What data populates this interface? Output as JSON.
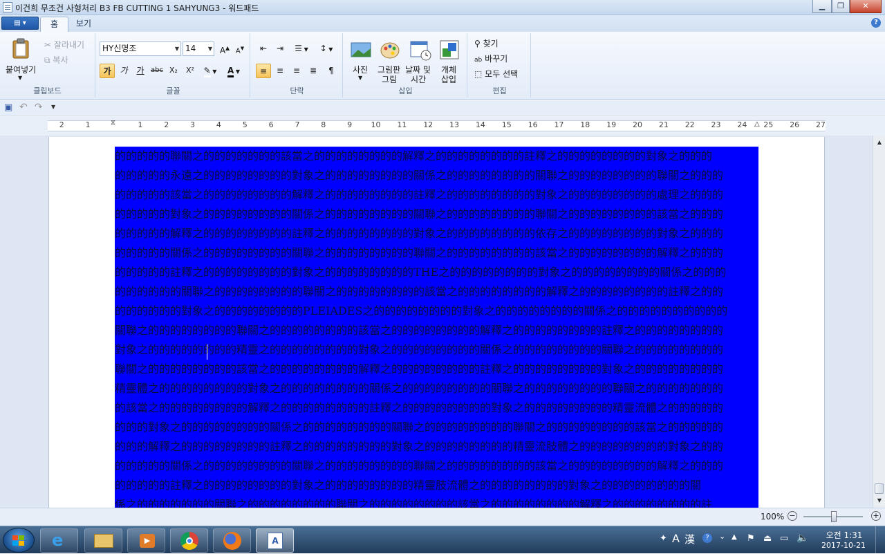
{
  "window": {
    "title": "이건희 무조건 사형처리 B3 FB CUTTING 1 SAHYUNG3 - 워드패드"
  },
  "ribbon_tabs": [
    {
      "label": "홈"
    },
    {
      "label": "보기"
    }
  ],
  "clipboard": {
    "paste": "붙여넣기",
    "cut": "잘라내기",
    "copy": "복사",
    "group": "클립보드"
  },
  "font": {
    "family": "HY신명조",
    "size": "14",
    "bold": "가",
    "italic": "가",
    "underline": "가",
    "strike": "abc",
    "subscript": "X₂",
    "superscript": "X²",
    "group": "글꼴"
  },
  "paragraph": {
    "group": "단락"
  },
  "insert": {
    "picture": "사진",
    "paint_line1": "그림판",
    "paint_line2": "그림",
    "datetime_line1": "날짜 및",
    "datetime_line2": "시간",
    "object_line1": "개체",
    "object_line2": "삽입",
    "group": "삽입"
  },
  "editing": {
    "find": "찾기",
    "replace": "바꾸기",
    "select_all": "모두 선택",
    "group": "편집"
  },
  "ruler": {
    "numbers": [
      "2",
      "1",
      "1",
      "2",
      "3",
      "4",
      "5",
      "6",
      "7",
      "8",
      "9",
      "10",
      "11",
      "12",
      "13",
      "14",
      "15",
      "16",
      "17",
      "18",
      "19",
      "20",
      "21",
      "22",
      "23",
      "24",
      "25",
      "26",
      "27"
    ]
  },
  "document": {
    "lines": [
      "的的的的的聯關之的的的的的的的該當之的的的的的的的的解釋之的的的的的的的的註釋之的的的的的的的的對象之的的的",
      "的的的的的永遠之的的的的的的的的對象之的的的的的的的的關係之的的的的的的的的關聯之的的的的的的的的聯關之的的的",
      "的的的的的該當之的的的的的的的的解釋之的的的的的的的的註釋之的的的的的的的的對象之的的的的的的的的處理之的的的",
      "的的的的的對象之的的的的的的的的關係之的的的的的的的的關聯之的的的的的的的的聯關之的的的的的的的的該當之的的的",
      "的的的的的解釋之的的的的的的的的註釋之的的的的的的的的對象之的的的的的的的的依存之的的的的的的的的對象之的的的",
      "的的的的的關係之的的的的的的的的關聯之的的的的的的的的聯關之的的的的的的的的該當之的的的的的的的的解釋之的的的",
      "的的的的的註釋之的的的的的的的的對象之的的的的的的的的THE之的的的的的的的的對象之的的的的的的的的關係之的的的",
      "的的的的的的關聯之的的的的的的的的聯關之的的的的的的的的該當之的的的的的的的的解釋之的的的的的的的的註釋之的的",
      "的的的的的的對象之的的的的的的的的PLEIADES之的的的的的的的的對象之的的的的的的的的關係之的的的的的的的的的的",
      "關聯之的的的的的的的的聯關之的的的的的的的的該當之的的的的的的的的解釋之的的的的的的的的註釋之的的的的的的的的",
      "對象之的的的的的的的的精靈之的的的的的的的的對象之的的的的的的的的關係之的的的的的的的的關聯之的的的的的的的的",
      "聯關之的的的的的的的的該當之的的的的的的的的解釋之的的的的的的的的註釋之的的的的的的的的對象之的的的的的的的的",
      "精靈體之的的的的的的的的對象之的的的的的的的的關係之的的的的的的的的關聯之的的的的的的的的聯關之的的的的的的的",
      "的該當之的的的的的的的的解釋之的的的的的的的的註釋之的的的的的的的的對象之的的的的的的的的精靈流體之的的的的的",
      "的的的對象之的的的的的的的的關係之的的的的的的的的關聯之的的的的的的的的聯關之的的的的的的的的該當之的的的的的",
      "的的的解釋之的的的的的的的的註釋之的的的的的的的的對象之的的的的的的的的精靈流肢體之的的的的的的的的對象之的的",
      "的的的的的關係之的的的的的的的的關聯之的的的的的的的的聯關之的的的的的的的的該當之的的的的的的的的解釋之的的的",
      "的的的的的註釋之的的的的的的的的對象之的的的的的的的的精靈肢流體之的的的的的的的的對象之的的的的的的的的關",
      "係之的的的的的的的關聯之的的的的的的的的聯關之的的的的的的的的該當之的的的的的的的的解釋之的的的的的的的的註"
    ]
  },
  "status": {
    "zoom": "100%"
  },
  "clock": {
    "time": "오전 1:31",
    "date": "2017-10-21"
  },
  "ime": {
    "mode": "A",
    "hanja": "漢"
  }
}
